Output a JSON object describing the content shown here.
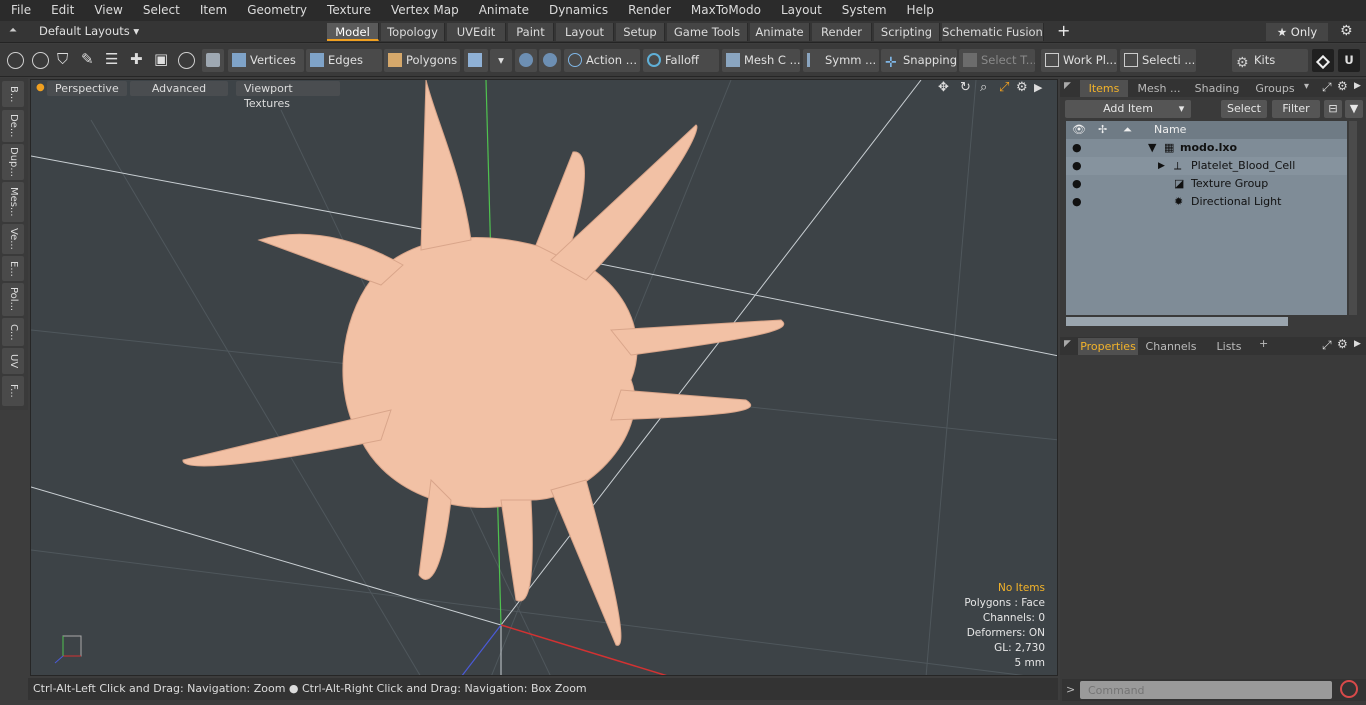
{
  "menu": [
    "File",
    "Edit",
    "View",
    "Select",
    "Item",
    "Geometry",
    "Texture",
    "Vertex Map",
    "Animate",
    "Dynamics",
    "Render",
    "MaxToModo",
    "Layout",
    "System",
    "Help"
  ],
  "layout_dropdown": "Default Layouts ▾",
  "main_tabs": [
    "Model",
    "Topology",
    "UVEdit",
    "Paint",
    "Layout",
    "Setup",
    "Game Tools",
    "Animate",
    "Render",
    "Scripting",
    "Schematic Fusion"
  ],
  "only_label": "★ Only",
  "toolbar": {
    "vertices": "Vertices",
    "edges": "Edges",
    "polygons": "Polygons",
    "action": "Action",
    "falloff": "Falloff",
    "mesh": "Mesh C ...",
    "symm": "Symm ...",
    "snapping": "Snapping",
    "select_t": "Select T...",
    "work_pl": "Work Pl...",
    "selecti": "Selecti ...",
    "kits": "Kits"
  },
  "left_tabs": [
    "B...",
    "De...",
    "Dup...",
    "Mes...",
    "Ve...",
    "E...",
    "Pol...",
    "C...",
    "UV",
    "F..."
  ],
  "viewport": {
    "view": "Perspective",
    "advanced": "Advanced",
    "textures": "Viewport Textures"
  },
  "info": {
    "no_items": "No Items",
    "polygons": "Polygons : Face",
    "channels": "Channels: 0",
    "deformers": "Deformers: ON",
    "gl": "GL: 2,730",
    "unit": "5 mm"
  },
  "status": "Ctrl-Alt-Left Click and Drag: Navigation: Zoom ● Ctrl-Alt-Right Click and Drag: Navigation: Box Zoom",
  "right_tabs": [
    "Items",
    "Mesh ...",
    "Shading",
    "Groups"
  ],
  "add_item": "Add Item",
  "select": "Select",
  "filter": "Filter",
  "col_name": "Name",
  "tree": [
    "modo.lxo",
    "Platelet_Blood_Cell",
    "Texture Group",
    "Directional Light"
  ],
  "prop_tabs": [
    "Properties",
    "Channels",
    "Lists"
  ],
  "command_placeholder": "Command",
  "colors": {
    "accent": "#f0a020",
    "cell": "#f2c1a5",
    "tree_bg": "#7f8c97"
  }
}
